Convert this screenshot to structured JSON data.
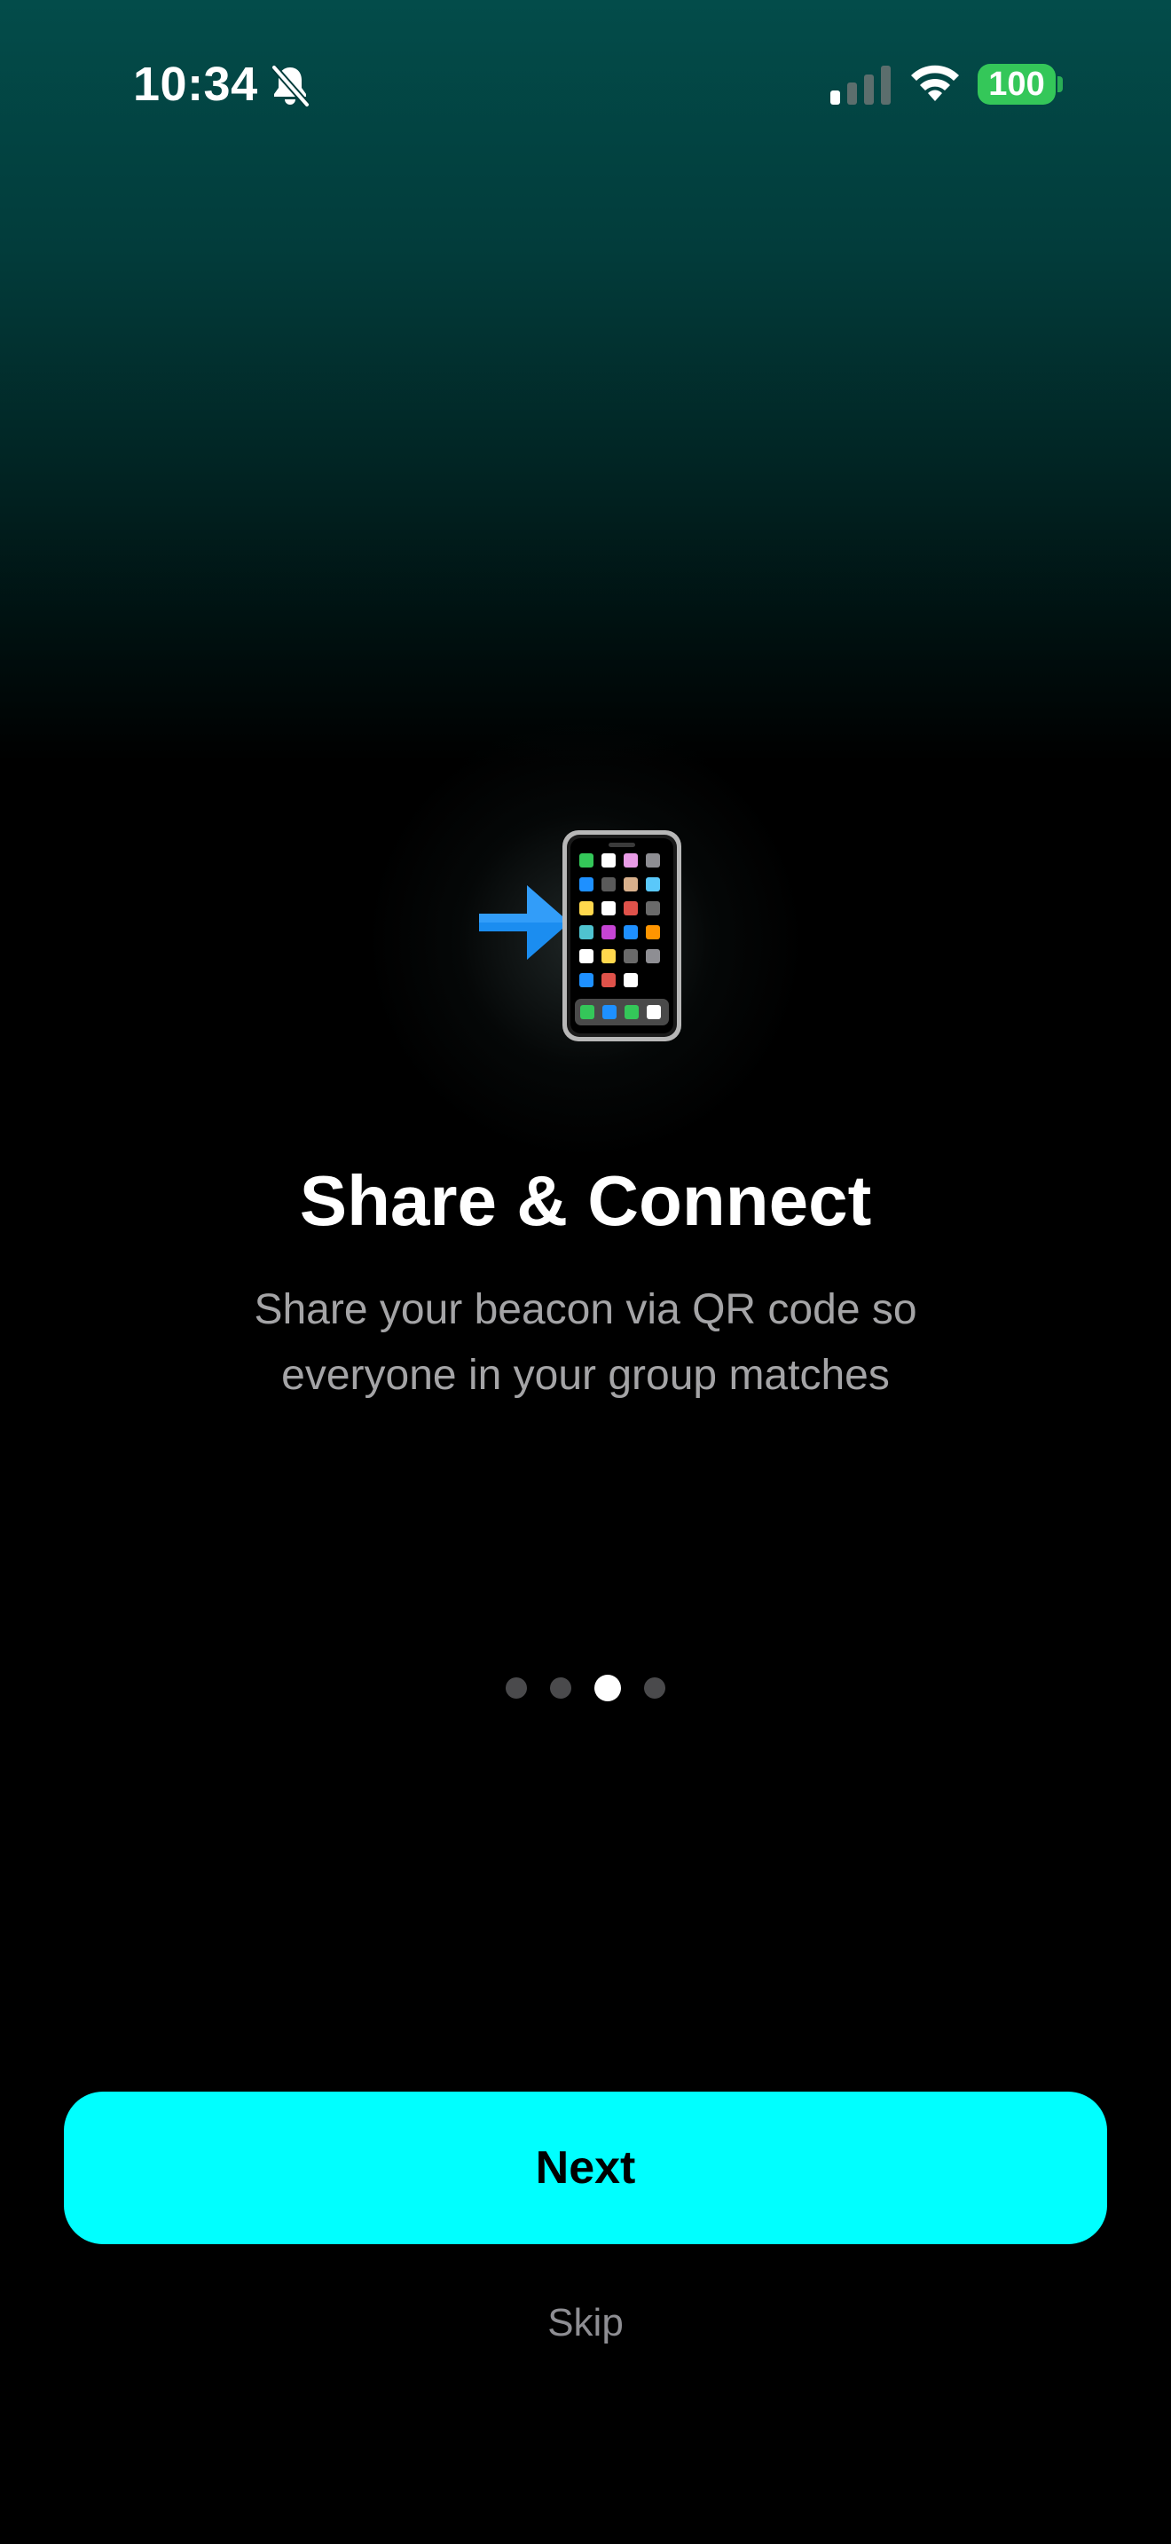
{
  "status_bar": {
    "time": "10:34",
    "battery_level": "100",
    "icons": [
      "bell-slash-icon",
      "cellular-signal-icon",
      "wifi-icon",
      "battery-icon"
    ],
    "battery_color": "#34c759"
  },
  "onboarding": {
    "illustration": "mobile-phone-with-arrow-icon",
    "title": "Share & Connect",
    "subtitle": "Share your beacon via QR code so everyone in your group matches",
    "page_count": 4,
    "current_page": 3
  },
  "actions": {
    "next_label": "Next",
    "skip_label": "Skip"
  },
  "colors": {
    "accent": "#00ffff",
    "background_top": "#034c4a",
    "background_bottom": "#000000",
    "subtitle_text": "#a4a4a6",
    "dot_inactive": "#4a4a4c",
    "dot_active": "#ffffff"
  }
}
